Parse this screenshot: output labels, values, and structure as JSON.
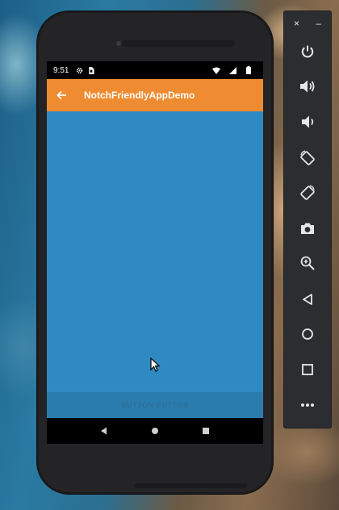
{
  "emulator_panel": {
    "close_label": "×",
    "minimize_label": "–",
    "buttons": [
      {
        "name": "power-icon"
      },
      {
        "name": "volume-up-icon"
      },
      {
        "name": "volume-down-icon"
      },
      {
        "name": "rotate-left-icon"
      },
      {
        "name": "rotate-right-icon"
      },
      {
        "name": "camera-icon"
      },
      {
        "name": "zoom-icon"
      },
      {
        "name": "back-icon"
      },
      {
        "name": "home-icon"
      },
      {
        "name": "overview-icon"
      },
      {
        "name": "more-icon"
      }
    ]
  },
  "status_bar": {
    "time": "9:51",
    "left_icons": [
      "gear-icon",
      "sim-icon"
    ],
    "right_icons": [
      "wifi-icon",
      "signal-icon",
      "battery-icon"
    ]
  },
  "app_bar": {
    "title": "NotchFriendlyAppDemo",
    "back_icon": "arrow-back-icon",
    "color": "#ef8b30"
  },
  "content": {
    "background": "#2f8ac2"
  },
  "bottom_button": {
    "label": "BUTTON BUTTON"
  },
  "nav_bar": {
    "buttons": [
      "back-triangle-icon",
      "home-circle-icon",
      "recents-square-icon"
    ]
  }
}
